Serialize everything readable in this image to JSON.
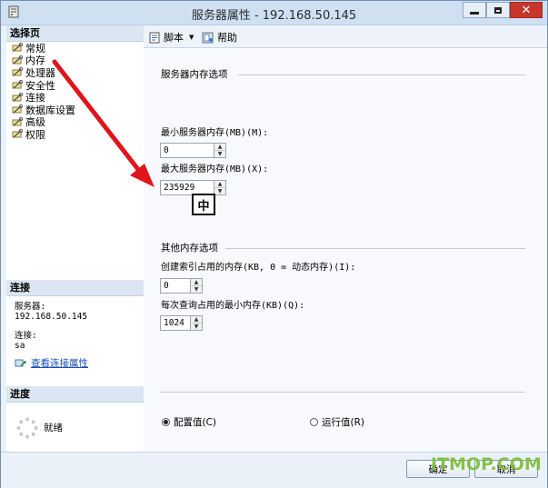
{
  "window": {
    "title": "服务器属性 - 192.168.50.145",
    "close_glyph": "✕"
  },
  "left": {
    "pages_header": "选择页",
    "pages": [
      "常规",
      "内存",
      "处理器",
      "安全性",
      "连接",
      "数据库设置",
      "高级",
      "权限"
    ],
    "connection_header": "连接",
    "server_label": "服务器:",
    "server_value": "192.168.50.145",
    "connection_label": "连接:",
    "connection_value": "sa",
    "view_link": "查看连接属性",
    "progress_header": "进度",
    "progress_status": "就绪"
  },
  "toolbar": {
    "script_label": "脚本",
    "script_caret": "▼",
    "help_label": "帮助"
  },
  "memory": {
    "group_title": "服务器内存选项",
    "min_label": "最小服务器内存(MB)(M):",
    "min_value": "0",
    "max_label": "最大服务器内存(MB)(X):",
    "max_value": "235929",
    "ime_indicator": "中",
    "other_title": "其他内存选项",
    "index_label": "创建索引占用的内存(KB, 0 = 动态内存)(I):",
    "index_value": "0",
    "query_label": "每次查询占用的最小内存(KB)(Q):",
    "query_value": "1024",
    "configured_label": "配置值(C)",
    "running_label": "运行值(R)"
  },
  "buttons": {
    "ok": "确定",
    "cancel": "取消"
  },
  "watermark": "ITMOP.COM",
  "colors": {
    "accent": "#1650b4",
    "arrow": "#e0141b",
    "close": "#c7362c",
    "watermark": "#7cbf3a"
  },
  "icons": [
    "server-icon",
    "wrench-icon",
    "script-icon",
    "help-icon",
    "link-icon",
    "spinner-icon",
    "red-arrow"
  ]
}
